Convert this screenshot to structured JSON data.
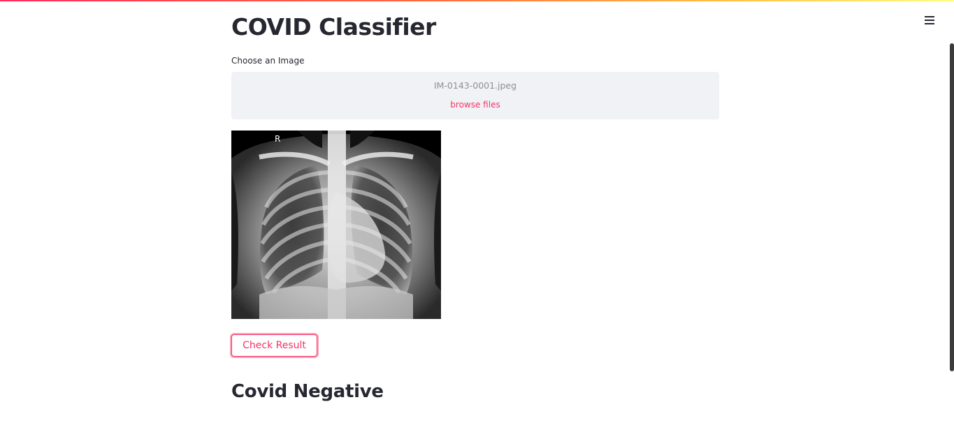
{
  "app": {
    "title": "COVID Classifier",
    "accent_color": "#f63366",
    "text_color": "#262730"
  },
  "header": {
    "menu_icon": "hamburger-menu-icon"
  },
  "uploader": {
    "label": "Choose an Image",
    "file_name": "IM-0143-0001.jpeg",
    "browse_label": "browse files"
  },
  "image": {
    "alt": "Chest X-ray",
    "marker": "R"
  },
  "action": {
    "button_label": "Check Result"
  },
  "result": {
    "heading": "Covid Negative"
  }
}
